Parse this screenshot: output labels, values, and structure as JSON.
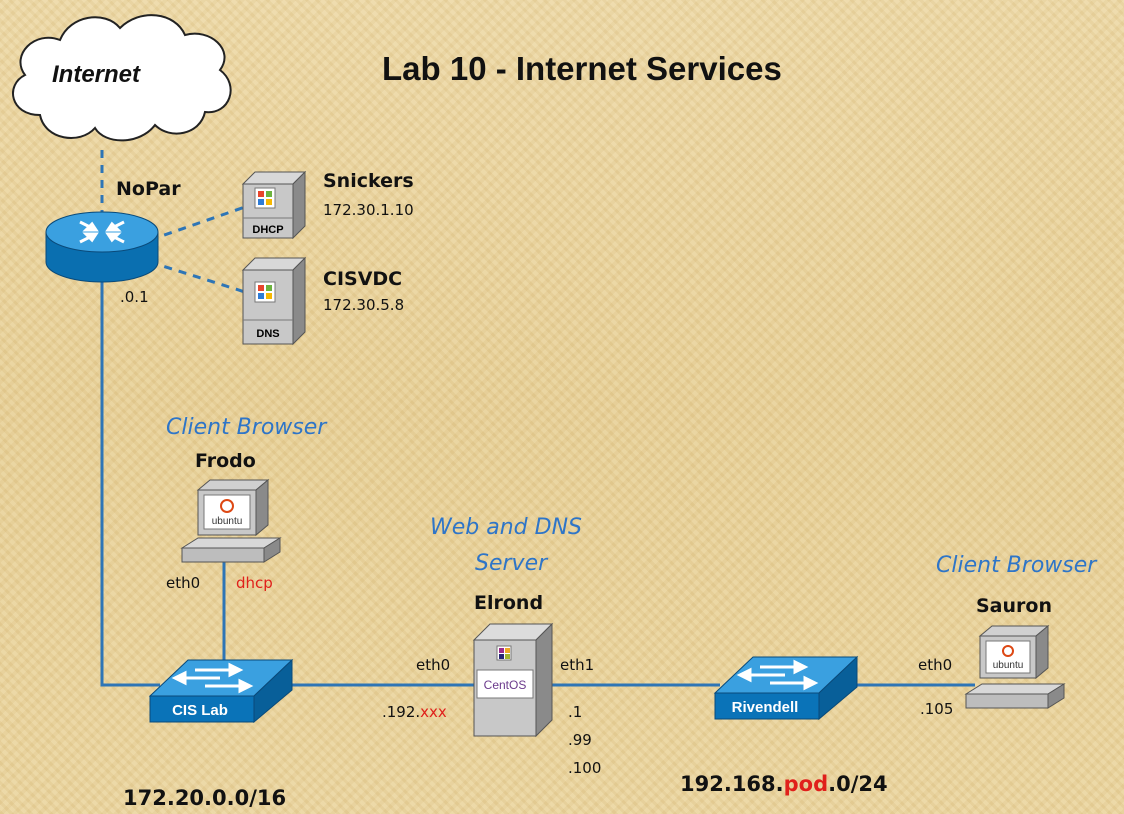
{
  "title": "Lab 10 - Internet Services",
  "cloud": {
    "label": "Internet"
  },
  "router": {
    "name": "NoPar",
    "ip": ".0.1"
  },
  "servers": {
    "snickers": {
      "name": "Snickers",
      "ip": "172.30.1.10",
      "tag": "DHCP"
    },
    "cisvdc": {
      "name": "CISVDC",
      "ip": "172.30.5.8",
      "tag": "DNS"
    }
  },
  "frodo": {
    "role": "Client Browser",
    "name": "Frodo",
    "iface": "eth0",
    "addr": "dhcp",
    "os": "ubuntu"
  },
  "elrond": {
    "role_line1": "Web and DNS",
    "role_line2": "Server",
    "name": "Elrond",
    "iface0": "eth0",
    "iface1": "eth1",
    "ip0_prefix": ".192.",
    "ip0_var": "xxx",
    "ips1": [
      ".1",
      ".99",
      ".100"
    ],
    "os": "CentOS"
  },
  "sauron": {
    "role": "Client Browser",
    "name": "Sauron",
    "iface": "eth0",
    "ip": ".105",
    "os": "ubuntu"
  },
  "switches": {
    "cislab": "CIS Lab",
    "rivendell": "Rivendell"
  },
  "networks": {
    "left": "172.20.0.0/16",
    "right_prefix": "192.168.",
    "right_var": "pod",
    "right_suffix": ".0/24"
  },
  "colors": {
    "link": "#2e75b6",
    "device_blue": "#0a73b8",
    "role_text": "#2e75c8",
    "variable_red": "#e0201b"
  }
}
